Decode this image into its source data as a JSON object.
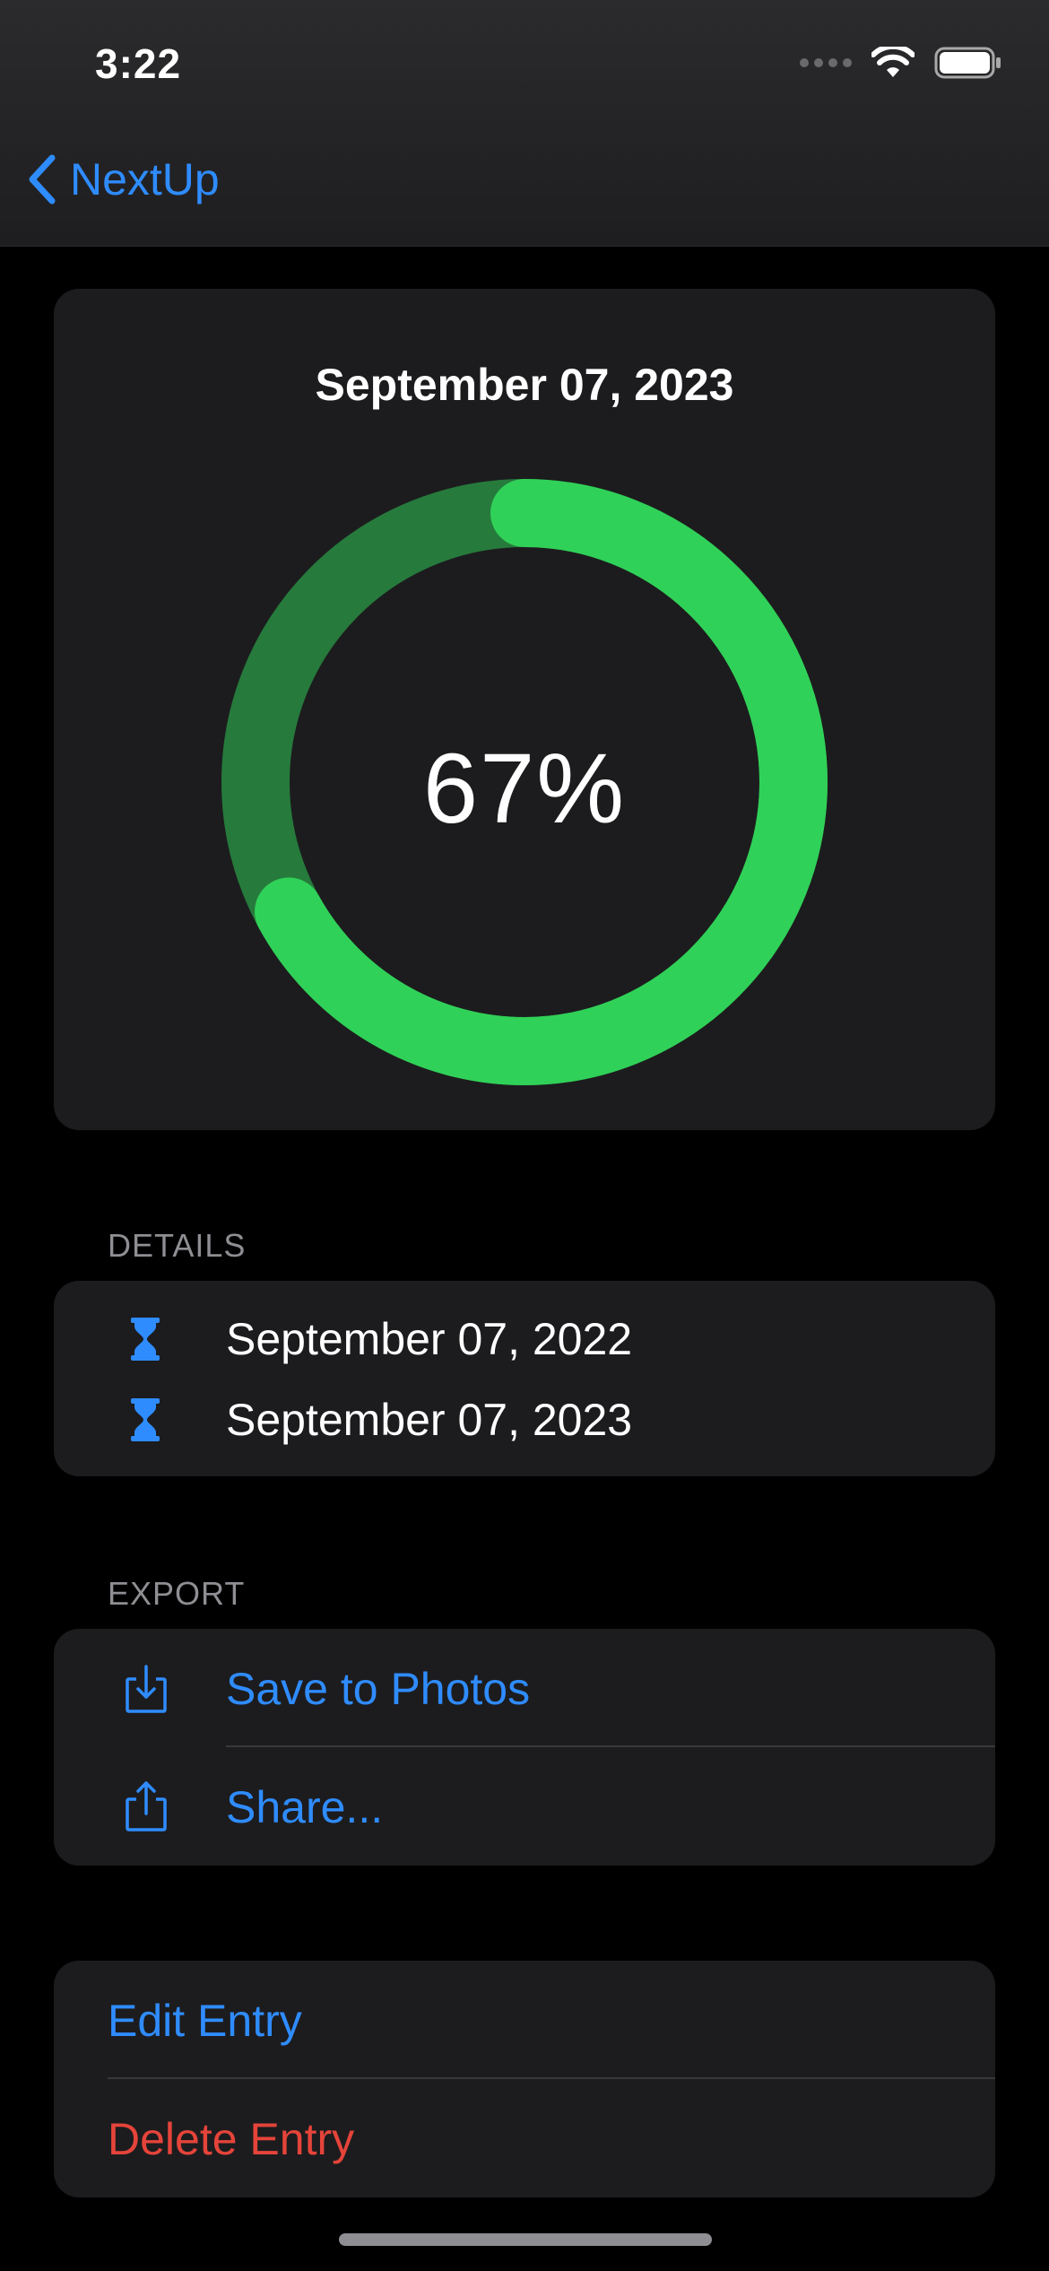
{
  "status_bar": {
    "time": "3:22",
    "icons": [
      "cellular-signal-icon",
      "wifi-icon",
      "battery-icon"
    ]
  },
  "nav": {
    "back_label": "NextUp",
    "back_icon": "chevron-left-icon"
  },
  "progress": {
    "date": "September 07, 2023",
    "percent_label": "67%",
    "fraction": 0.67
  },
  "details": {
    "section_label": "DETAILS",
    "items": [
      {
        "icon": "hourglass-icon",
        "text": "September 07, 2022"
      },
      {
        "icon": "hourglass-icon",
        "text": "September 07, 2023"
      }
    ]
  },
  "export": {
    "section_label": "EXPORT",
    "items": [
      {
        "icon": "save-to-photos-icon",
        "label": "Save to Photos"
      },
      {
        "icon": "share-icon",
        "label": "Share..."
      }
    ]
  },
  "manage": {
    "edit_label": "Edit Entry",
    "delete_label": "Delete Entry"
  },
  "colors": {
    "accent": "#2f8cff",
    "ring_fill": "#30d158",
    "ring_track": "#267a3c",
    "destructive": "#e5443a",
    "card_bg": "#1c1c1e"
  }
}
